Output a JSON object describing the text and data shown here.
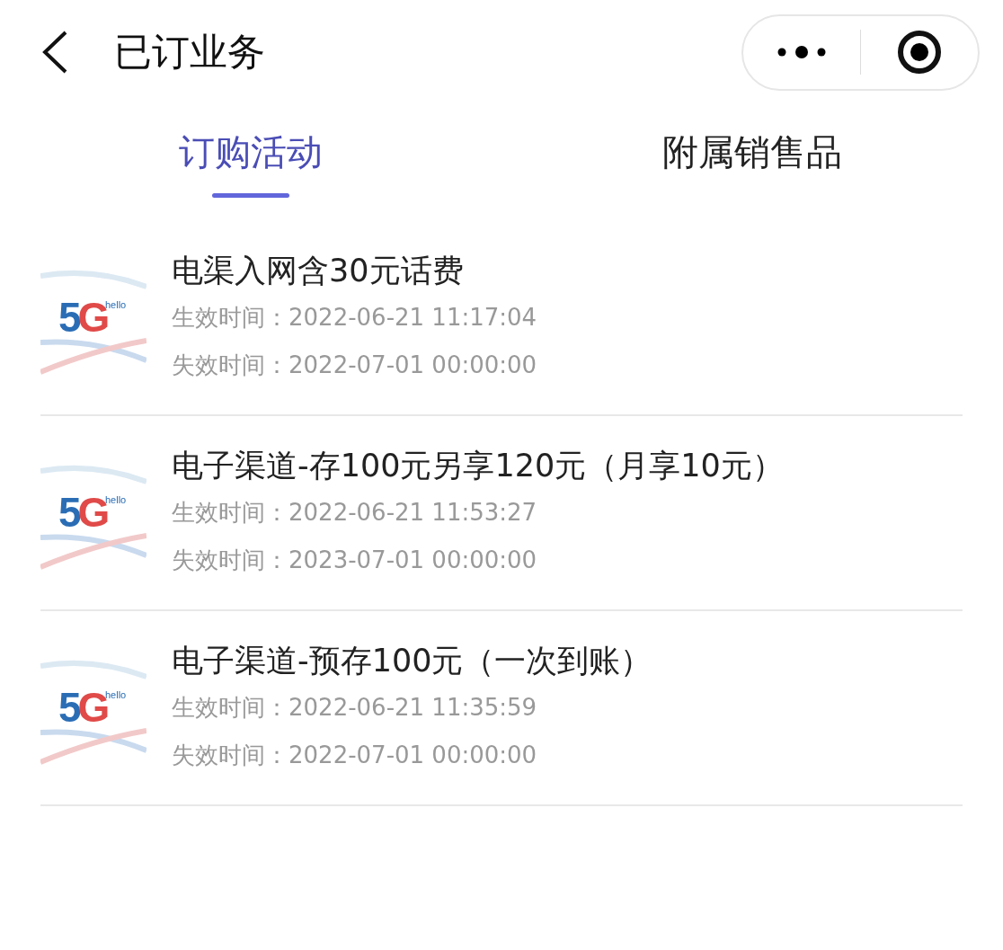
{
  "header": {
    "title": "已订业务"
  },
  "tabs": [
    {
      "label": "订购活动",
      "selected": true
    },
    {
      "label": "附属销售品",
      "selected": false
    }
  ],
  "orders": [
    {
      "logo": {
        "mark": "5G",
        "caption": "hello"
      },
      "name": "电渠入网含30元话费",
      "start_label": "生效时间：",
      "start": "2022-06-21 11:17:04",
      "end_label": "失效时间：",
      "end": "2022-07-01 00:00:00"
    },
    {
      "logo": {
        "mark": "5G",
        "caption": "hello"
      },
      "name": "电子渠道-存100元另享120元（月享10元）",
      "start_label": "生效时间：",
      "start": "2022-06-21 11:53:27",
      "end_label": "失效时间：",
      "end": "2023-07-01 00:00:00"
    },
    {
      "logo": {
        "mark": "5G",
        "caption": "hello"
      },
      "name": "电子渠道-预存100元（一次到账）",
      "start_label": "生效时间：",
      "start": "2022-06-21 11:35:59",
      "end_label": "失效时间：",
      "end": "2022-07-01 00:00:00"
    }
  ]
}
